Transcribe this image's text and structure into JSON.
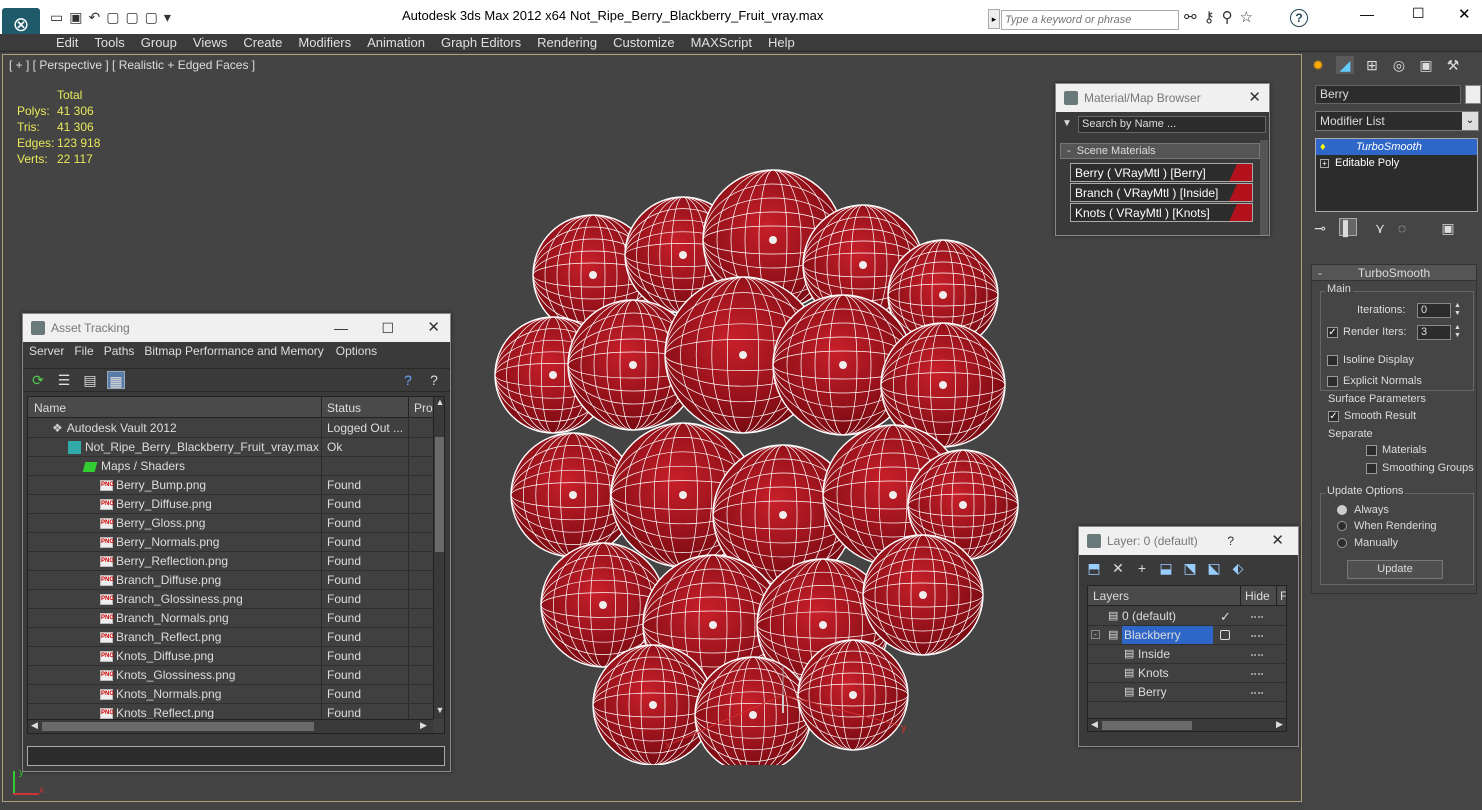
{
  "titlebar": {
    "app": "Autodesk 3ds Max  2012 x64",
    "file": "Not_Ripe_Berry_Blackberry_Fruit_vray.max",
    "search_placeholder": "Type a keyword or phrase"
  },
  "menu": [
    "Edit",
    "Tools",
    "Group",
    "Views",
    "Create",
    "Modifiers",
    "Animation",
    "Graph Editors",
    "Rendering",
    "Customize",
    "MAXScript",
    "Help"
  ],
  "viewport": {
    "label": "[ + ] [ Perspective ] [ Realistic + Edged Faces ]",
    "stats_header": "Total",
    "stats": [
      {
        "k": "Polys:",
        "v": "41 306"
      },
      {
        "k": "Tris:",
        "v": "41 306"
      },
      {
        "k": "Edges:",
        "v": "123 918"
      },
      {
        "k": "Verts:",
        "v": "22 117"
      }
    ],
    "axis_x": "x",
    "axis_y": "y",
    "gizmo_x": "x",
    "gizmo_y": "y"
  },
  "material_browser": {
    "title": "Material/Map Browser",
    "search": "Search by Name ...",
    "group": "Scene Materials",
    "materials": [
      "Berry  ( VRayMtl )  [Berry]",
      "Branch  ( VRayMtl )  [Inside]",
      "Knots  ( VRayMtl )  [Knots]"
    ]
  },
  "asset_tracking": {
    "title": "Asset Tracking",
    "menu": [
      "Server",
      "File",
      "Paths",
      "Bitmap Performance and Memory",
      "Options"
    ],
    "columns": [
      "Name",
      "Status",
      "Pro"
    ],
    "rows": [
      {
        "name": "Autodesk Vault 2012",
        "status": "Logged Out ...",
        "indent": 0
      },
      {
        "name": "Not_Ripe_Berry_Blackberry_Fruit_vray.max",
        "status": "Ok",
        "indent": 1
      },
      {
        "name": "Maps / Shaders",
        "status": "",
        "indent": 2
      },
      {
        "name": "Berry_Bump.png",
        "status": "Found",
        "indent": 3
      },
      {
        "name": "Berry_Diffuse.png",
        "status": "Found",
        "indent": 3
      },
      {
        "name": "Berry_Gloss.png",
        "status": "Found",
        "indent": 3
      },
      {
        "name": "Berry_Normals.png",
        "status": "Found",
        "indent": 3
      },
      {
        "name": "Berry_Reflection.png",
        "status": "Found",
        "indent": 3
      },
      {
        "name": "Branch_Diffuse.png",
        "status": "Found",
        "indent": 3
      },
      {
        "name": "Branch_Glossiness.png",
        "status": "Found",
        "indent": 3
      },
      {
        "name": "Branch_Normals.png",
        "status": "Found",
        "indent": 3
      },
      {
        "name": "Branch_Reflect.png",
        "status": "Found",
        "indent": 3
      },
      {
        "name": "Knots_Diffuse.png",
        "status": "Found",
        "indent": 3
      },
      {
        "name": "Knots_Glossiness.png",
        "status": "Found",
        "indent": 3
      },
      {
        "name": "Knots_Normals.png",
        "status": "Found",
        "indent": 3
      },
      {
        "name": "Knots_Reflect.png",
        "status": "Found",
        "indent": 3
      }
    ]
  },
  "layer_panel": {
    "title": "Layer: 0 (default)",
    "help": "?",
    "col_layers": "Layers",
    "col_hide": "Hide",
    "col_f": "F",
    "rows": [
      {
        "name": "0 (default)",
        "check": "✓",
        "selected": false
      },
      {
        "name": "Blackberry",
        "check": "",
        "selected": true
      },
      {
        "name": "Inside",
        "check": "",
        "selected": false
      },
      {
        "name": "Knots",
        "check": "",
        "selected": false
      },
      {
        "name": "Berry",
        "check": "",
        "selected": false
      }
    ]
  },
  "command_panel": {
    "object_name": "Berry",
    "modifier_list": "Modifier List",
    "stack": [
      "TurboSmooth",
      "Editable Poly"
    ],
    "rollout": "TurboSmooth",
    "main": "Main",
    "iterations_label": "Iterations:",
    "iterations": "0",
    "render_iters_label": "Render Iters:",
    "render_iters": "3",
    "isoline": "Isoline Display",
    "explicit": "Explicit Normals",
    "surface": "Surface Parameters",
    "smooth_result": "Smooth Result",
    "separate": "Separate",
    "materials": "Materials",
    "smoothing_groups": "Smoothing Groups",
    "update_options": "Update Options",
    "always": "Always",
    "when_rendering": "When Rendering",
    "manually": "Manually",
    "update": "Update"
  },
  "colors": {
    "berry": "#b3111b",
    "selection": "#2f67c8",
    "yellow": "#e8e85a"
  }
}
